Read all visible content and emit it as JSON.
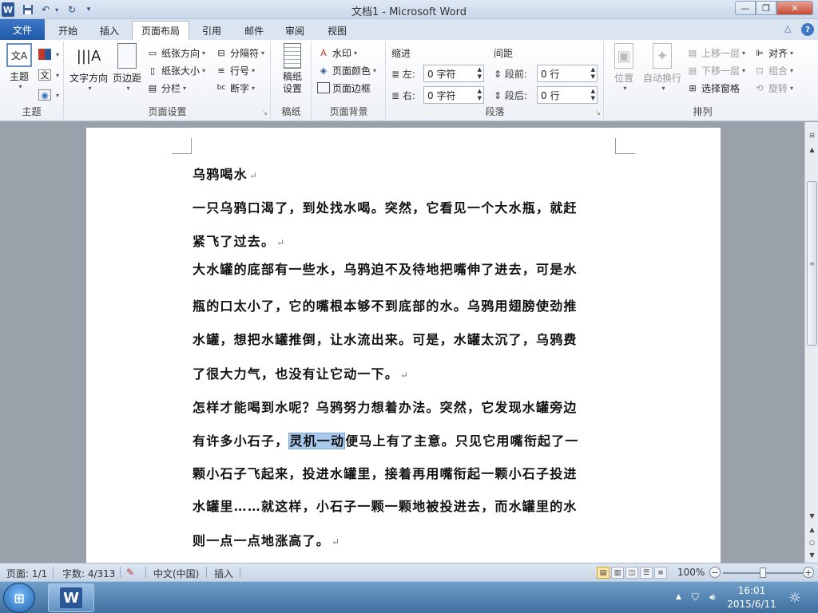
{
  "titlebar": {
    "app_icon": "W",
    "title": "文档1 - Microsoft Word",
    "save_icon": "save-icon",
    "undo_icon": "undo-icon",
    "redo_icon": "redo-icon",
    "minimize": "—",
    "maximize": "❐",
    "close": "✕"
  },
  "tabs": {
    "file": "文件",
    "home": "开始",
    "insert": "插入",
    "layout": "页面布局",
    "references": "引用",
    "mailings": "邮件",
    "review": "审阅",
    "view": "视图"
  },
  "ribbon": {
    "theme": {
      "label": "主题",
      "themes": "主题"
    },
    "page_setup": {
      "label": "页面设置",
      "text_direction": "文字方向",
      "margins": "页边距",
      "orientation": "纸张方向",
      "size": "纸张大小",
      "columns": "分栏",
      "breaks": "分隔符",
      "line_numbers": "行号",
      "hyphenation": "断字"
    },
    "draft": {
      "label": "稿纸",
      "draft_setup": "稿纸\n设置"
    },
    "page_background": {
      "label": "页面背景",
      "watermark": "水印",
      "page_color": "页面颜色",
      "page_borders": "页面边框"
    },
    "paragraph": {
      "label": "段落",
      "indent_title": "缩进",
      "spacing_title": "间距",
      "left_label": "左:",
      "right_label": "右:",
      "before_label": "段前:",
      "after_label": "段后:",
      "left_value": "0 字符",
      "right_value": "0 字符",
      "before_value": "0 行",
      "after_value": "0 行"
    },
    "arrange": {
      "label": "排列",
      "position": "位置",
      "wrap_text": "自动换行",
      "bring_forward": "上移一层",
      "send_backward": "下移一层",
      "selection_pane": "选择窗格",
      "align": "对齐",
      "group": "组合",
      "rotate": "旋转"
    }
  },
  "document": {
    "title": "乌鸦喝水",
    "p1": [
      "一只乌鸦口渴了，到处找水喝。突然，它看见一个大水瓶，就赶",
      "紧飞了过去。"
    ],
    "p2": [
      "大水罐的底部有一些水，乌鸦迫不及待地把嘴伸了进去，可是水",
      "瓶的口太小了，它的嘴根本够不到底部的水。乌鸦用翅膀使劲推",
      "水罐，想把水罐推倒，让水流出来。可是，水罐太沉了，乌鸦费",
      "了很大力气，也没有让它动一下。"
    ],
    "p3_l1": "怎样才能喝到水呢？乌鸦努力想着办法。突然，它发现水罐旁边",
    "p3_l2_before": "有许多小石子，",
    "p3_l2_selected": "灵机一动",
    "p3_l2_after": "便马上有了主意。只见它用嘴衔起了一",
    "p3_l3": "颗小石子飞起来，投进水罐里，接着再用嘴衔起一颗小石子投进",
    "p3_l4": "水罐里……就这样，小石子一颗一颗地被投进去，而水罐里的水",
    "p3_l5": "则一点一点地涨高了。",
    "para_mark": "↵"
  },
  "statusbar": {
    "page": "页面: 1/1",
    "words": "字数: 4/313",
    "language": "中文(中国)",
    "mode": "插入",
    "zoom": "100%",
    "zoom_level": 1.0
  },
  "taskbar": {
    "clock_time": "16:01",
    "clock_date": "2015/6/11",
    "word_button": "W"
  }
}
